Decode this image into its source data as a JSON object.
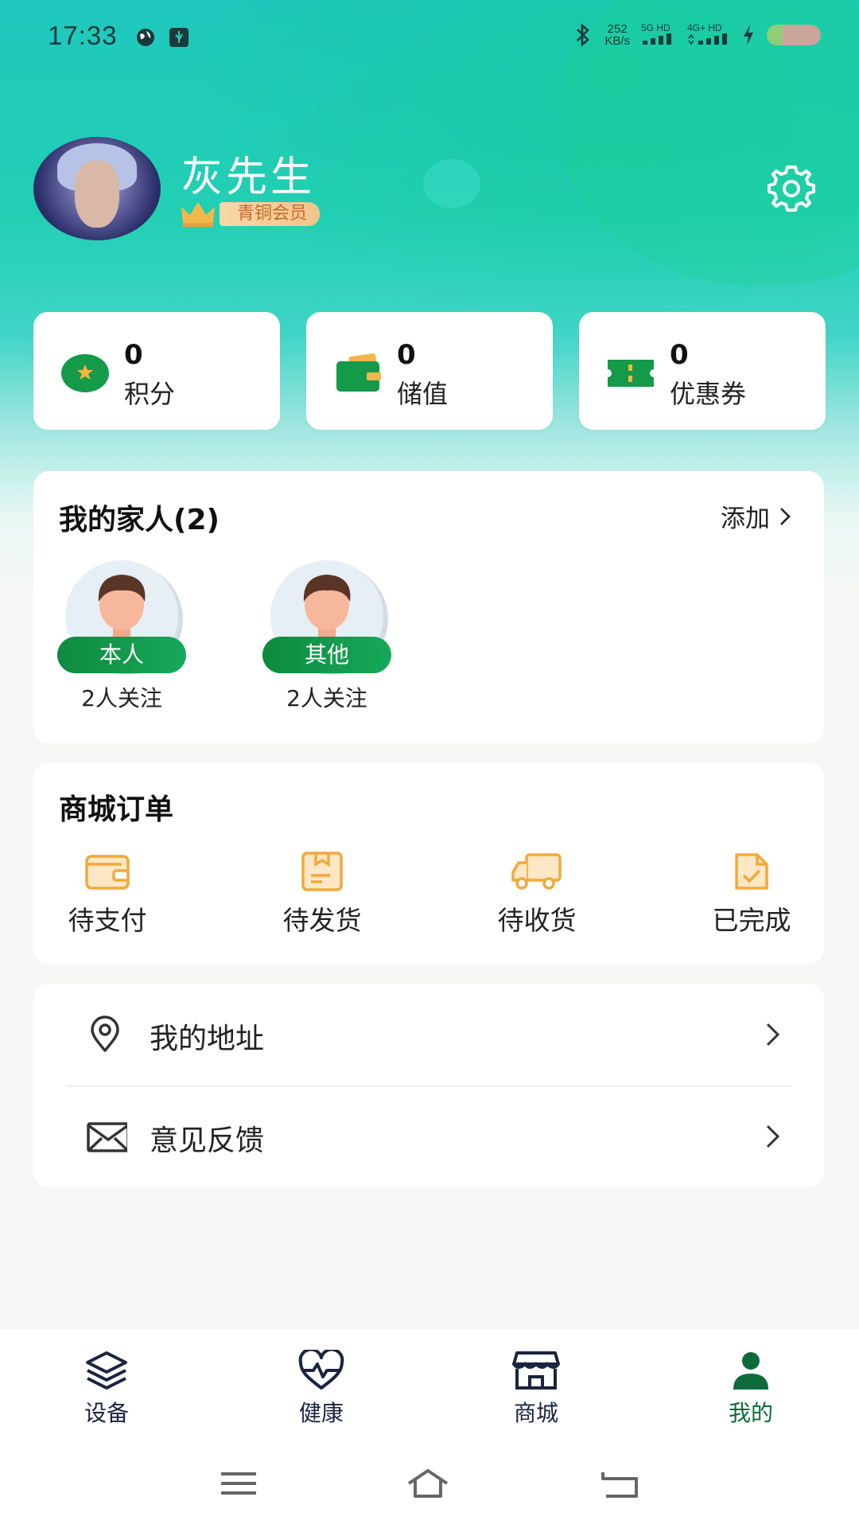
{
  "status_bar": {
    "time": "17:33",
    "net_speed_value": "252",
    "net_speed_unit": "KB/s",
    "sig1": "5G HD",
    "sig2": "4G+ HD",
    "battery_level": 0.3
  },
  "profile": {
    "name": "灰先生",
    "member_level": "青铜会员"
  },
  "stats": [
    {
      "value": "0",
      "label": "积分",
      "icon": "points-coin-icon"
    },
    {
      "value": "0",
      "label": "储值",
      "icon": "wallet-icon"
    },
    {
      "value": "0",
      "label": "优惠券",
      "icon": "coupon-ticket-icon"
    }
  ],
  "family": {
    "title": "我的家人(2)",
    "add_label": "添加",
    "members": [
      {
        "tag": "本人",
        "followers": "2人关注"
      },
      {
        "tag": "其他",
        "followers": "2人关注"
      }
    ]
  },
  "orders": {
    "title": "商城订单",
    "items": [
      {
        "label": "待支付",
        "icon": "wallet-outline-icon"
      },
      {
        "label": "待发货",
        "icon": "package-box-icon"
      },
      {
        "label": "待收货",
        "icon": "delivery-truck-icon"
      },
      {
        "label": "已完成",
        "icon": "document-check-icon"
      }
    ]
  },
  "menu": [
    {
      "label": "我的地址",
      "icon": "location-pin-icon"
    },
    {
      "label": "意见反馈",
      "icon": "envelope-icon"
    }
  ],
  "bottom_nav": [
    {
      "label": "设备",
      "icon": "layers-stack-icon",
      "active": false
    },
    {
      "label": "健康",
      "icon": "heart-pulse-icon",
      "active": false
    },
    {
      "label": "商城",
      "icon": "store-front-icon",
      "active": false
    },
    {
      "label": "我的",
      "icon": "user-person-icon",
      "active": true
    }
  ],
  "colors": {
    "accent_green": "#0d6b3a",
    "tag_green": "#17a85a",
    "order_icon_orange": "#f2a93b",
    "hero_teal": "#1ec8bd"
  }
}
